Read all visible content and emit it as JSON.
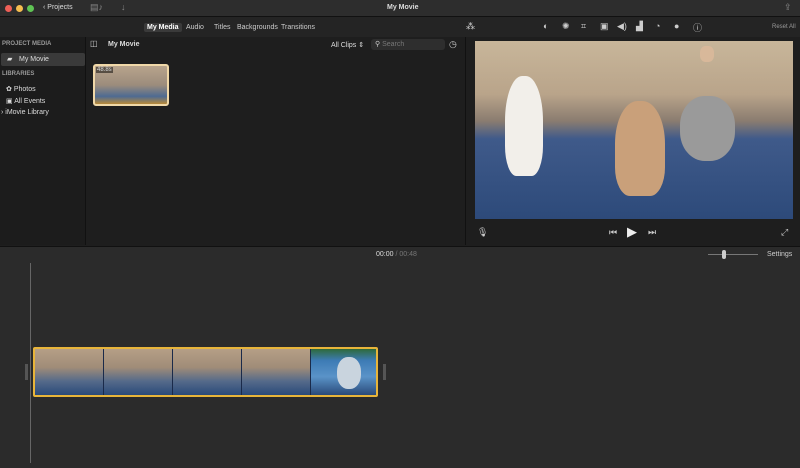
{
  "window": {
    "title": "My Movie"
  },
  "titlebar": {
    "back_label": "Projects"
  },
  "toolbar": {
    "tabs": [
      "My Media",
      "Audio",
      "Titles",
      "Backgrounds",
      "Transitions"
    ],
    "active_tab": "My Media",
    "reset_label": "Reset All",
    "adjust_icons": [
      "color-balance-icon",
      "color-correction-icon",
      "crop-icon",
      "stabilization-icon",
      "volume-icon",
      "noise-reduction-icon",
      "speed-icon",
      "clip-filter-icon",
      "info-icon"
    ]
  },
  "sidebar": {
    "project_header": "PROJECT MEDIA",
    "project_item": "My Movie",
    "libraries_header": "LIBRARIES",
    "items": [
      "Photos",
      "All Events"
    ],
    "library": "iMovie Library"
  },
  "browser": {
    "title": "My Movie",
    "filter": "All Clips",
    "search_placeholder": "Search",
    "clip_duration": "48.8s"
  },
  "timeline": {
    "current_time": "00:00",
    "separator": "/",
    "total_time": "00:48",
    "settings_label": "Settings",
    "zoom_level": 0.3
  },
  "colors": {
    "accent": "#e8b53a",
    "selection": "#3a3a3a"
  }
}
